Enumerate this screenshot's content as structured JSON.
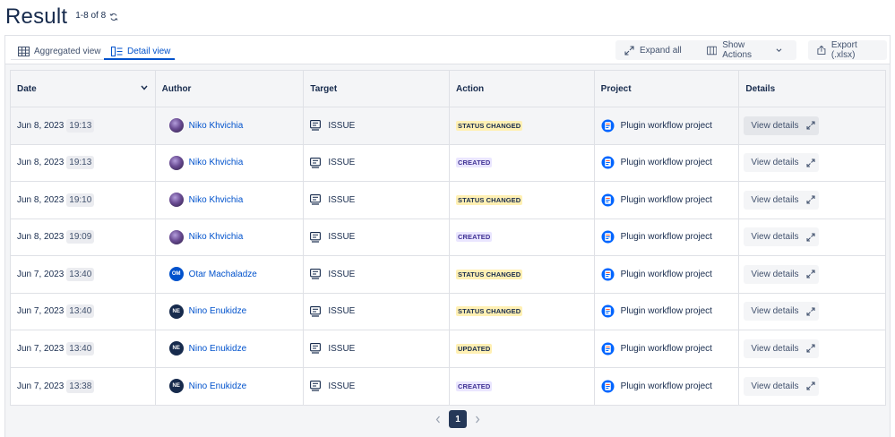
{
  "header": {
    "title": "Result",
    "count": "1-8 of 8"
  },
  "tabs": [
    {
      "label": "Aggregated view",
      "active": false
    },
    {
      "label": "Detail view",
      "active": true
    }
  ],
  "toolbar": {
    "expand_all": "Expand all",
    "show_actions": "Show Actions",
    "export": "Export (.xlsx)"
  },
  "columns": [
    "Date",
    "Author",
    "Target",
    "Action",
    "Project",
    "Details"
  ],
  "rows": [
    {
      "date": "Jun 8, 2023",
      "time": "19:13",
      "author": "Niko Khvichia",
      "avatar": "photo",
      "initials": "",
      "target": "ISSUE",
      "action": "STATUS CHANGED",
      "action_kind": "status",
      "project": "Plugin workflow project",
      "details": "View details"
    },
    {
      "date": "Jun 8, 2023",
      "time": "19:13",
      "author": "Niko Khvichia",
      "avatar": "photo",
      "initials": "",
      "target": "ISSUE",
      "action": "CREATED",
      "action_kind": "created",
      "project": "Plugin workflow project",
      "details": "View details"
    },
    {
      "date": "Jun 8, 2023",
      "time": "19:10",
      "author": "Niko Khvichia",
      "avatar": "photo",
      "initials": "",
      "target": "ISSUE",
      "action": "STATUS CHANGED",
      "action_kind": "status",
      "project": "Plugin workflow project",
      "details": "View details"
    },
    {
      "date": "Jun 8, 2023",
      "time": "19:09",
      "author": "Niko Khvichia",
      "avatar": "photo",
      "initials": "",
      "target": "ISSUE",
      "action": "CREATED",
      "action_kind": "created",
      "project": "Plugin workflow project",
      "details": "View details"
    },
    {
      "date": "Jun 7, 2023",
      "time": "13:40",
      "author": "Otar Machaladze",
      "avatar": "om",
      "initials": "OM",
      "target": "ISSUE",
      "action": "STATUS CHANGED",
      "action_kind": "status",
      "project": "Plugin workflow project",
      "details": "View details"
    },
    {
      "date": "Jun 7, 2023",
      "time": "13:40",
      "author": "Nino Enukidze",
      "avatar": "ne",
      "initials": "NE",
      "target": "ISSUE",
      "action": "STATUS CHANGED",
      "action_kind": "status",
      "project": "Plugin workflow project",
      "details": "View details"
    },
    {
      "date": "Jun 7, 2023",
      "time": "13:40",
      "author": "Nino Enukidze",
      "avatar": "ne",
      "initials": "NE",
      "target": "ISSUE",
      "action": "UPDATED",
      "action_kind": "updated",
      "project": "Plugin workflow project",
      "details": "View details"
    },
    {
      "date": "Jun 7, 2023",
      "time": "13:38",
      "author": "Nino Enukidze",
      "avatar": "ne",
      "initials": "NE",
      "target": "ISSUE",
      "action": "CREATED",
      "action_kind": "created",
      "project": "Plugin workflow project",
      "details": "View details"
    }
  ],
  "pagination": {
    "current": "1"
  },
  "colors": {
    "link": "#0052cc",
    "status_lozenge": "#fff0b3",
    "created_lozenge": "#eae6ff",
    "page_active": "#253858"
  },
  "icons": {
    "refresh": "refresh-icon",
    "aggregated": "table-grid-icon",
    "detail": "list-detail-icon",
    "expand": "expand-icon",
    "columns": "columns-icon",
    "export": "export-icon",
    "target": "issue-icon",
    "project": "project-icon"
  }
}
